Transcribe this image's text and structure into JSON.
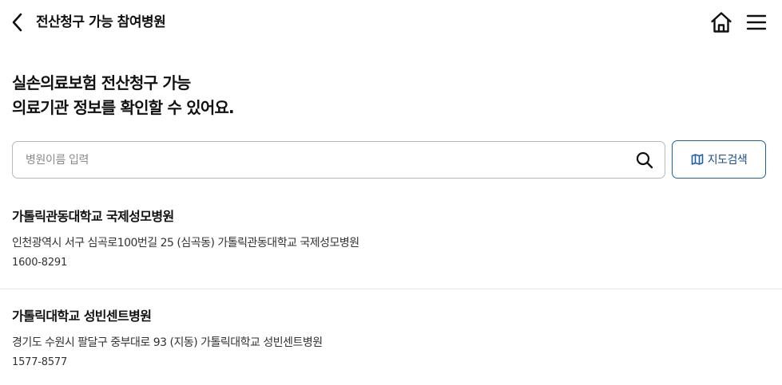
{
  "header": {
    "title": "전산청구 가능 참여병원",
    "back_icon": "chevron-left-icon",
    "home_icon": "home-icon",
    "menu_icon": "hamburger-menu-icon"
  },
  "headline": {
    "line1": "실손의료보험 전산청구 가능",
    "line2": "의료기관 정보를 확인할 수 있어요."
  },
  "search": {
    "placeholder": "병원이름 입력",
    "value": "",
    "icon": "search-icon"
  },
  "map_button": {
    "label": "지도검색",
    "icon": "map-icon"
  },
  "hospitals": [
    {
      "name": "가톨릭관동대학교 국제성모병원",
      "address": "인천광역시 서구 심곡로100번길 25 (심곡동) 가톨릭관동대학교 국제성모병원",
      "phone": "1600-8291"
    },
    {
      "name": "가톨릭대학교 성빈센트병원",
      "address": "경기도 수원시 팔달구 중부대로 93 (지동) 가톨릭대학교 성빈센트병원",
      "phone": "1577-8577"
    }
  ],
  "colors": {
    "accent": "#1f5fa8",
    "text": "#111111",
    "border": "#b9b9b9",
    "divider": "#e4e4e4"
  }
}
